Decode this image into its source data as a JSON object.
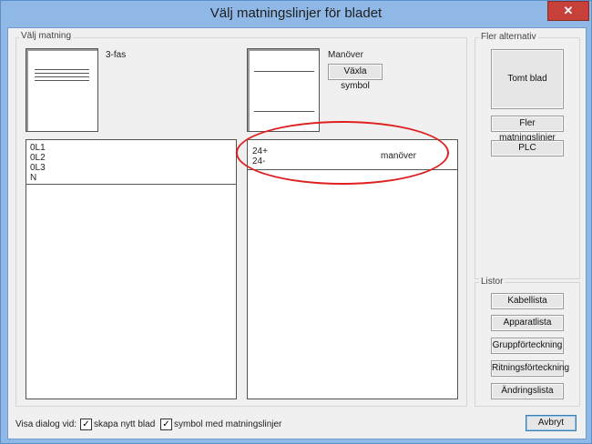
{
  "window": {
    "title": "Välj matningslinjer för bladet",
    "close_glyph": "✕"
  },
  "matning": {
    "group_title": "Välj matning",
    "left_preview_label": "3-fas",
    "right_preview_label": "Manöver",
    "toggle_symbol_button": "Växla symbol",
    "left_list_items": [
      "0L1",
      "0L2",
      "0L3",
      "N"
    ],
    "right_list_items": [
      "24+",
      "24-"
    ],
    "right_list_tag": "manöver"
  },
  "fler_alternativ": {
    "group_title": "Fler alternativ",
    "empty_sheet_button": "Tomt blad",
    "more_lines_button": "Fler matningslinjer",
    "plc_button": "PLC"
  },
  "listor": {
    "group_title": "Listor",
    "buttons": [
      "Kabellista",
      "Apparatlista",
      "Gruppförteckning",
      "Ritningsförteckning",
      "Ändringslista"
    ]
  },
  "footer": {
    "show_dialog_label": "Visa dialog vid:",
    "check_new_sheet": "skapa nytt blad",
    "check_symbol": "symbol med matningslinjer",
    "check_mark": "✓",
    "cancel_button": "Avbryt"
  }
}
